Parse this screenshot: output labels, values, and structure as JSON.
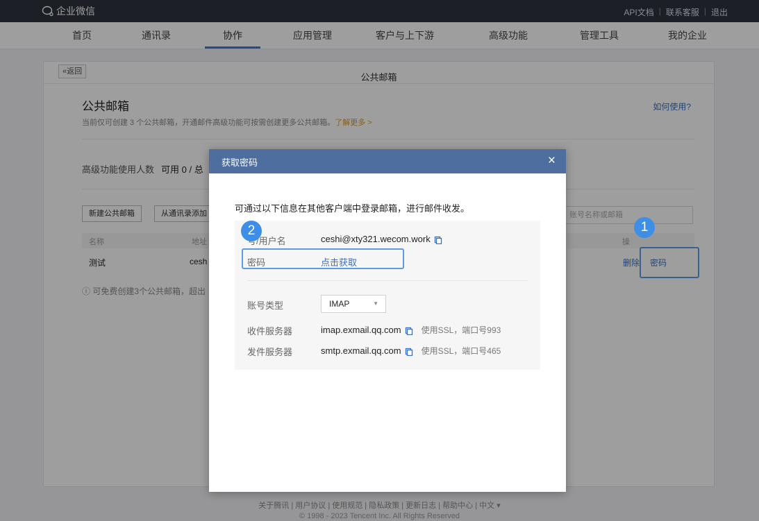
{
  "brand": {
    "name": "企业微信"
  },
  "top_links": [
    "API文档",
    "联系客服",
    "退出"
  ],
  "nav": {
    "items": [
      "首页",
      "通讯录",
      "协作",
      "应用管理",
      "客户与上下游",
      "高级功能",
      "管理工具",
      "我的企业"
    ],
    "active": "协作"
  },
  "panel": {
    "back_label": "«返回",
    "header_title": "公共邮箱",
    "section_title": "公共邮箱",
    "desc": "当前仅可创建 3 个公共邮箱，开通邮件高级功能可按需创建更多公共邮箱。",
    "learn_more": "了解更多 >",
    "howto": "如何使用?",
    "usage_label": "高级功能使用人数",
    "usage_value": "可用 0 / 总",
    "btn_new": "新建公共邮箱",
    "btn_add_from_contacts": "从通讯录添加",
    "search_placeholder": "账号名称或邮箱",
    "table": {
      "headers": [
        "名称",
        "地址",
        "操"
      ],
      "row": {
        "name": "测试",
        "address": "cesh",
        "delete": "删除",
        "password": "密码"
      }
    },
    "note": "可免费创建3个公共邮箱，超出"
  },
  "badges": {
    "one": "1",
    "two": "2"
  },
  "modal": {
    "title": "获取密码",
    "close": "×",
    "intro": "可通过以下信息在其他客户端中登录邮箱，进行邮件收发。",
    "account_label": "号/用户名",
    "account_value": "ceshi@xty321.wecom.work",
    "password_label": "密码",
    "password_action": "点击获取",
    "account_type_label": "账号类型",
    "account_type_value": "IMAP",
    "incoming_label": "收件服务器",
    "incoming_value": "imap.exmail.qq.com",
    "incoming_ssl": "使用SSL，端口号993",
    "outgoing_label": "发件服务器",
    "outgoing_value": "smtp.exmail.qq.com",
    "outgoing_ssl": "使用SSL，端口号465"
  },
  "footer": {
    "links": "关于腾讯 | 用户协议 | 使用规范 | 隐私政策 | 更新日志 | 帮助中心 | 中文 ▾",
    "copyright": "© 1998 - 2023 Tencent Inc. All Rights Reserved"
  },
  "colors": {
    "accent": "#3a7bd5",
    "modal_header": "#4d6e9f",
    "topbar": "#2f3340",
    "highlight": "#5a9be6",
    "learn_more": "#d99a27"
  }
}
